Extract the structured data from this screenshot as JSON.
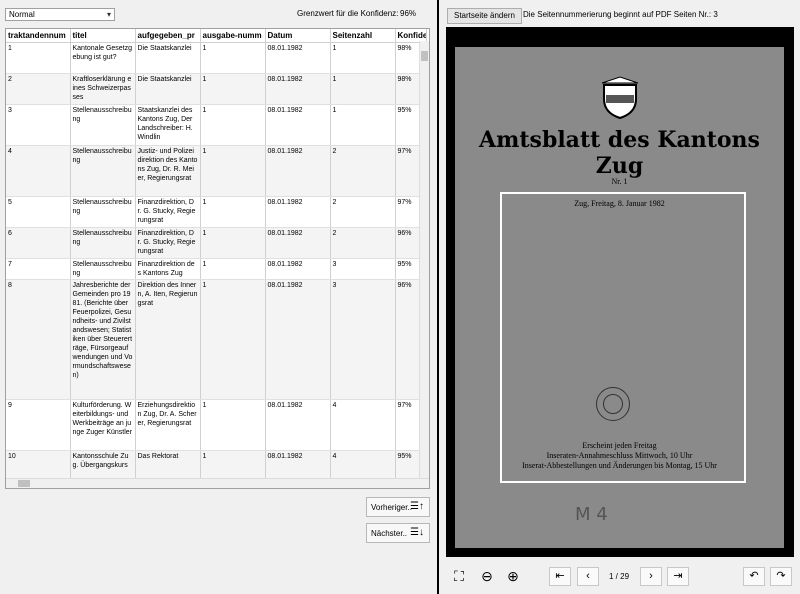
{
  "left": {
    "mode_select": "Normal",
    "confidence_label": "Grenzwert für die Konfidenz:",
    "confidence_value": "96%",
    "columns": [
      "traktandennum",
      "titel",
      "aufgegeben_pr",
      "ausgabe-numm",
      "Datum",
      "Seitenzahl",
      "Konfidenz"
    ],
    "rows": [
      [
        "1",
        "Kantonale Gesetzgebung ist gut?",
        "Die Staatskanzlei",
        "1",
        "08.01.1982",
        "1",
        "98%"
      ],
      [
        "2",
        "Kraftloserklärung eines Schweizerpasses",
        "Die Staatskanzlei",
        "1",
        "08.01.1982",
        "1",
        "98%"
      ],
      [
        "3",
        "Stellenausschreibung",
        "Staatskanzlei des Kantons Zug, Der Landschreiber: H. Windlin",
        "1",
        "08.01.1982",
        "1",
        "95%"
      ],
      [
        "4",
        "Stellenausschreibung",
        "Justiz- und Polizeidirektion des Kantons Zug, Dr. R. Meier, Regierungsrat",
        "1",
        "08.01.1982",
        "2",
        "97%"
      ],
      [
        "5",
        "Stellenausschreibung",
        "Finanzdirektion, Dr. G. Stucky, Regierungsrat",
        "1",
        "08.01.1982",
        "2",
        "97%"
      ],
      [
        "6",
        "Stellenausschreibung",
        "Finanzdirektion, Dr. G. Stucky, Regierungsrat",
        "1",
        "08.01.1982",
        "2",
        "96%"
      ],
      [
        "7",
        "Stellenausschreibung",
        "Finanzdirektion des Kantons Zug",
        "1",
        "08.01.1982",
        "3",
        "95%"
      ],
      [
        "8",
        "Jahresberichte der Gemeinden pro 1981. (Berichte über Feuerpolizei, Gesundheits- und Zivilstandswesen; Statistiken über Steuererträge, Fürsorgeaufwendungen und Vormundschaftswesen)",
        "Direktion des Innern, A. Iten, Regierungsrat",
        "1",
        "08.01.1982",
        "3",
        "96%"
      ],
      [
        "9",
        "Kulturförderung. Weiterbildungs- und Werkbeiträge an junge Zuger Künstler",
        "Erziehungsdirektion Zug, Dr. A. Scherer, Regierungsrat",
        "1",
        "08.01.1982",
        "4",
        "97%"
      ],
      [
        "10",
        "Kantonsschule Zug. Übergangskurs",
        "Das Rektorat",
        "1",
        "08.01.1982",
        "4",
        "95%"
      ]
    ],
    "prev_label": "Vorheriger..",
    "next_label": "Nächster.."
  },
  "right": {
    "start_button": "Startseite ändern",
    "start_info": "Die Seitennummerierung beginnt auf PDF Seiten Nr.:  3",
    "page_indicator": "1 / 29",
    "pdf": {
      "title": "Amtsblatt des Kantons Zug",
      "number": "Nr. 1",
      "dateline": "Zug, Freitag, 8. Januar 1982",
      "footer1": "Erscheint jeden Freitag",
      "footer2": "Inseraten-Annahmeschluss Mittwoch, 10 Uhr",
      "footer3": "Inserat-Abbestellungen und Änderungen bis Montag, 15 Uhr",
      "handwriting": "M 4"
    }
  }
}
